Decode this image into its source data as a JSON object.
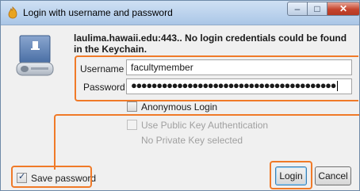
{
  "window": {
    "title": "Login with username and password",
    "minimize_glyph": "–",
    "maximize_glyph": "□",
    "close_glyph": "✕"
  },
  "message": "laulima.hawaii.edu:443.. No login credentials could be found in the Keychain.",
  "username": {
    "label": "Username",
    "value": "facultymember"
  },
  "password": {
    "label": "Password",
    "value": "●●●●●●●●●●●●●●●●●●●●●●●●●●●●●●●●●●●●●●●●"
  },
  "anonymous_login": {
    "label": "Anonymous Login",
    "checked": false
  },
  "public_key": {
    "label": "Use Public Key Authentication",
    "checked": false,
    "enabled": false
  },
  "private_key_status": "No Private Key selected",
  "save_password": {
    "label": "Save password",
    "checked": true
  },
  "buttons": {
    "login": "Login",
    "cancel": "Cancel"
  },
  "icons": [
    "app-icon",
    "drive-icon",
    "minimize-icon",
    "maximize-icon",
    "close-icon",
    "checkbox-icon"
  ],
  "colors": {
    "highlight": "#f07a28",
    "title_bar": "#b9d1ec",
    "close_button": "#c6452e"
  }
}
